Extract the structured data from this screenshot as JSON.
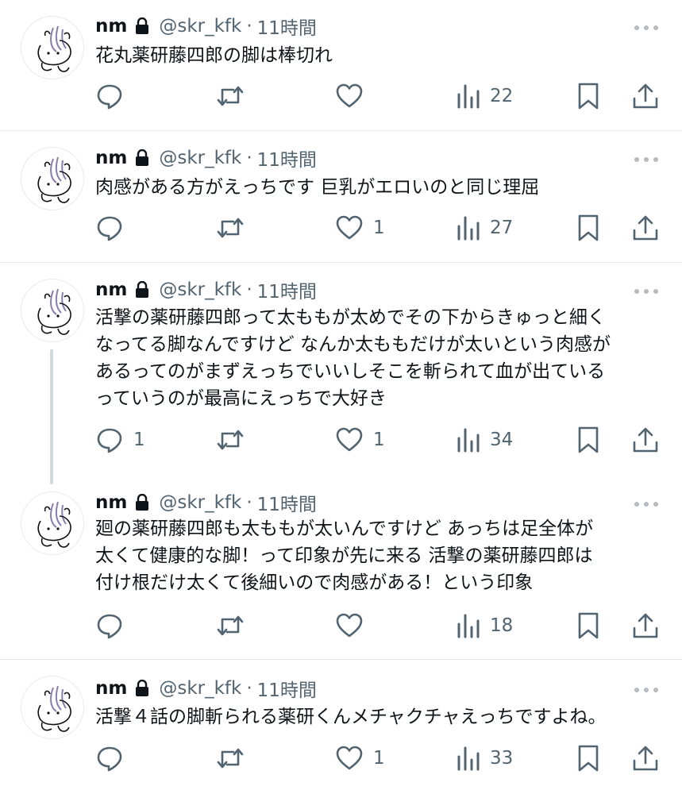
{
  "tweets": [
    {
      "name": "nm",
      "handle": "@skr_kfk",
      "separator": "·",
      "time": "11時間",
      "text": "花丸薬研藤四郎の脚は棒切れ",
      "replies": "",
      "retweets": "",
      "likes": "",
      "views": "22"
    },
    {
      "name": "nm",
      "handle": "@skr_kfk",
      "separator": "·",
      "time": "11時間",
      "text": "肉感がある方がえっちです 巨乳がエロいのと同じ理屈",
      "replies": "",
      "retweets": "",
      "likes": "1",
      "views": "27"
    },
    {
      "name": "nm",
      "handle": "@skr_kfk",
      "separator": "·",
      "time": "11時間",
      "text": "活撃の薬研藤四郎って太ももが太めでその下からきゅっと細く\nなってる脚なんですけど なんか太ももだけが太いという肉感が\nあるってのがまずえっちでいいしそこを斬られて血が出ている\nっていうのが最高にえっちで大好き",
      "replies": "1",
      "retweets": "",
      "likes": "1",
      "views": "34"
    },
    {
      "name": "nm",
      "handle": "@skr_kfk",
      "separator": "·",
      "time": "11時間",
      "text": "廻の薬研藤四郎も太ももが太いんですけど あっちは足全体が\n太くて健康的な脚！って印象が先に来る 活撃の薬研藤四郎は\n付け根だけ太くて後細いので肉感がある！という印象",
      "replies": "",
      "retweets": "",
      "likes": "",
      "views": "18"
    },
    {
      "name": "nm",
      "handle": "@skr_kfk",
      "separator": "·",
      "time": "11時間",
      "text": "活撃４話の脚斬られる薬研くんメチャクチャえっちですよね。",
      "replies": "",
      "retweets": "",
      "likes": "1",
      "views": "33"
    }
  ],
  "icons": {
    "lock": "lock-icon",
    "more": "more-options-icon",
    "reply": "reply-icon",
    "retweet": "retweet-icon",
    "like": "like-icon",
    "views": "views-icon",
    "bookmark": "bookmark-icon",
    "share": "share-icon"
  },
  "colors": {
    "text": "#0f1419",
    "secondary": "#536471",
    "divider": "#e6e9ec",
    "thread_line": "#cfd9de",
    "avatar_scribble": "#8a7db0"
  }
}
